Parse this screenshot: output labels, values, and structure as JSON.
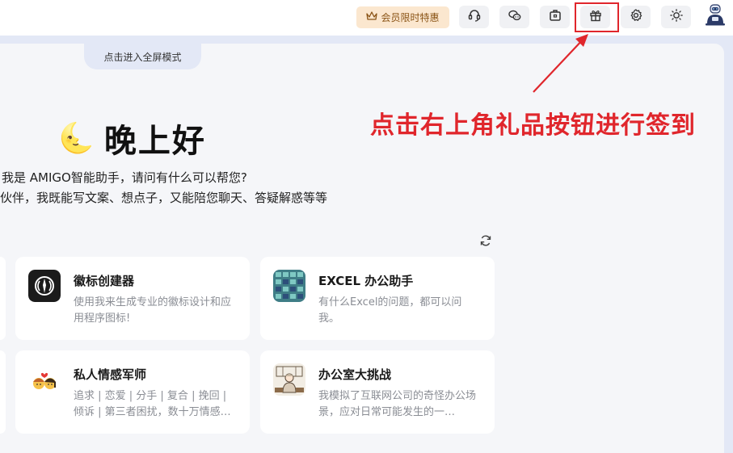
{
  "toolbar": {
    "vip_label": "会员限时特惠",
    "buttons": [
      {
        "icon": "headset-icon"
      },
      {
        "icon": "wechat-icon"
      },
      {
        "icon": "briefcase-icon"
      },
      {
        "icon": "gift-icon"
      },
      {
        "icon": "gear-icon"
      },
      {
        "icon": "sun-icon"
      }
    ],
    "avatar_icon": "robot-avatar-icon"
  },
  "main": {
    "fullscreen_label": "点击进入全屏模式",
    "greeting_emoji": "🌜",
    "greeting": "晚上好",
    "intro_line1": "我是 AMIGO智能助手，请问有什么可以帮您?",
    "intro_line2": "伙伴，我既能写文案、想点子，又能陪您聊天、答疑解惑等等",
    "cards": [
      {
        "title": "徽标创建器",
        "desc": "使用我来生成专业的徽标设计和应用程序图标!",
        "icon": "logo-creator-icon"
      },
      {
        "title": "EXCEL 办公助手",
        "desc": "有什么Excel的问题，都可以问我。",
        "icon": "excel-assistant-icon"
      },
      {
        "title": "私人情感军师",
        "desc": "追求 | 恋爱 | 分手 | 复合 | 挽回 | 倾诉 | 第三者困扰，数十万情感…",
        "icon": "couple-emoji-icon"
      },
      {
        "title": "办公室大挑战",
        "desc": "我模拟了互联网公司的奇怪办公场景，应对日常可能发生的一…",
        "icon": "office-challenge-icon"
      }
    ]
  },
  "annotation": {
    "text": "点击右上角礼品按钮进行签到",
    "color": "#e0262c"
  },
  "colors": {
    "accent_red": "#e0262c",
    "vip_bg": "#fbe7cf",
    "panel_bg": "#f5f6f9",
    "outer_bg": "#e3e8f6"
  }
}
